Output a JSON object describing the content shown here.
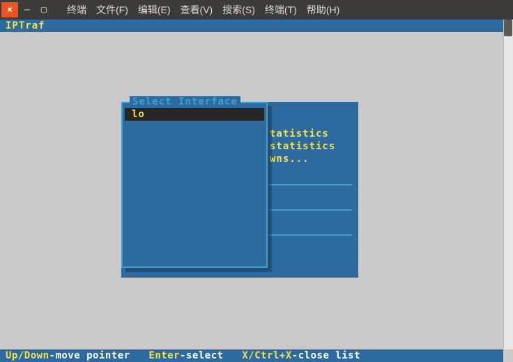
{
  "window": {
    "close_glyph": "×",
    "min_glyph": "—",
    "max_glyph": "▢"
  },
  "menu": {
    "items": [
      "终端",
      "文件(F)",
      "编辑(E)",
      "查看(V)",
      "搜索(S)",
      "终端(T)",
      "帮助(H)"
    ]
  },
  "app": {
    "title": "IPTraf"
  },
  "background_panel": {
    "frag1": "tatistics",
    "frag2": "statistics",
    "frag3": "wns..."
  },
  "dialog": {
    "title": "Select Interface",
    "items": [
      "lo"
    ]
  },
  "status": {
    "k1": "Up/Down",
    "v1": "-move pointer",
    "k2": "Enter",
    "v2": "-select",
    "k3": "X/Ctrl+X",
    "v3": "-close list"
  }
}
